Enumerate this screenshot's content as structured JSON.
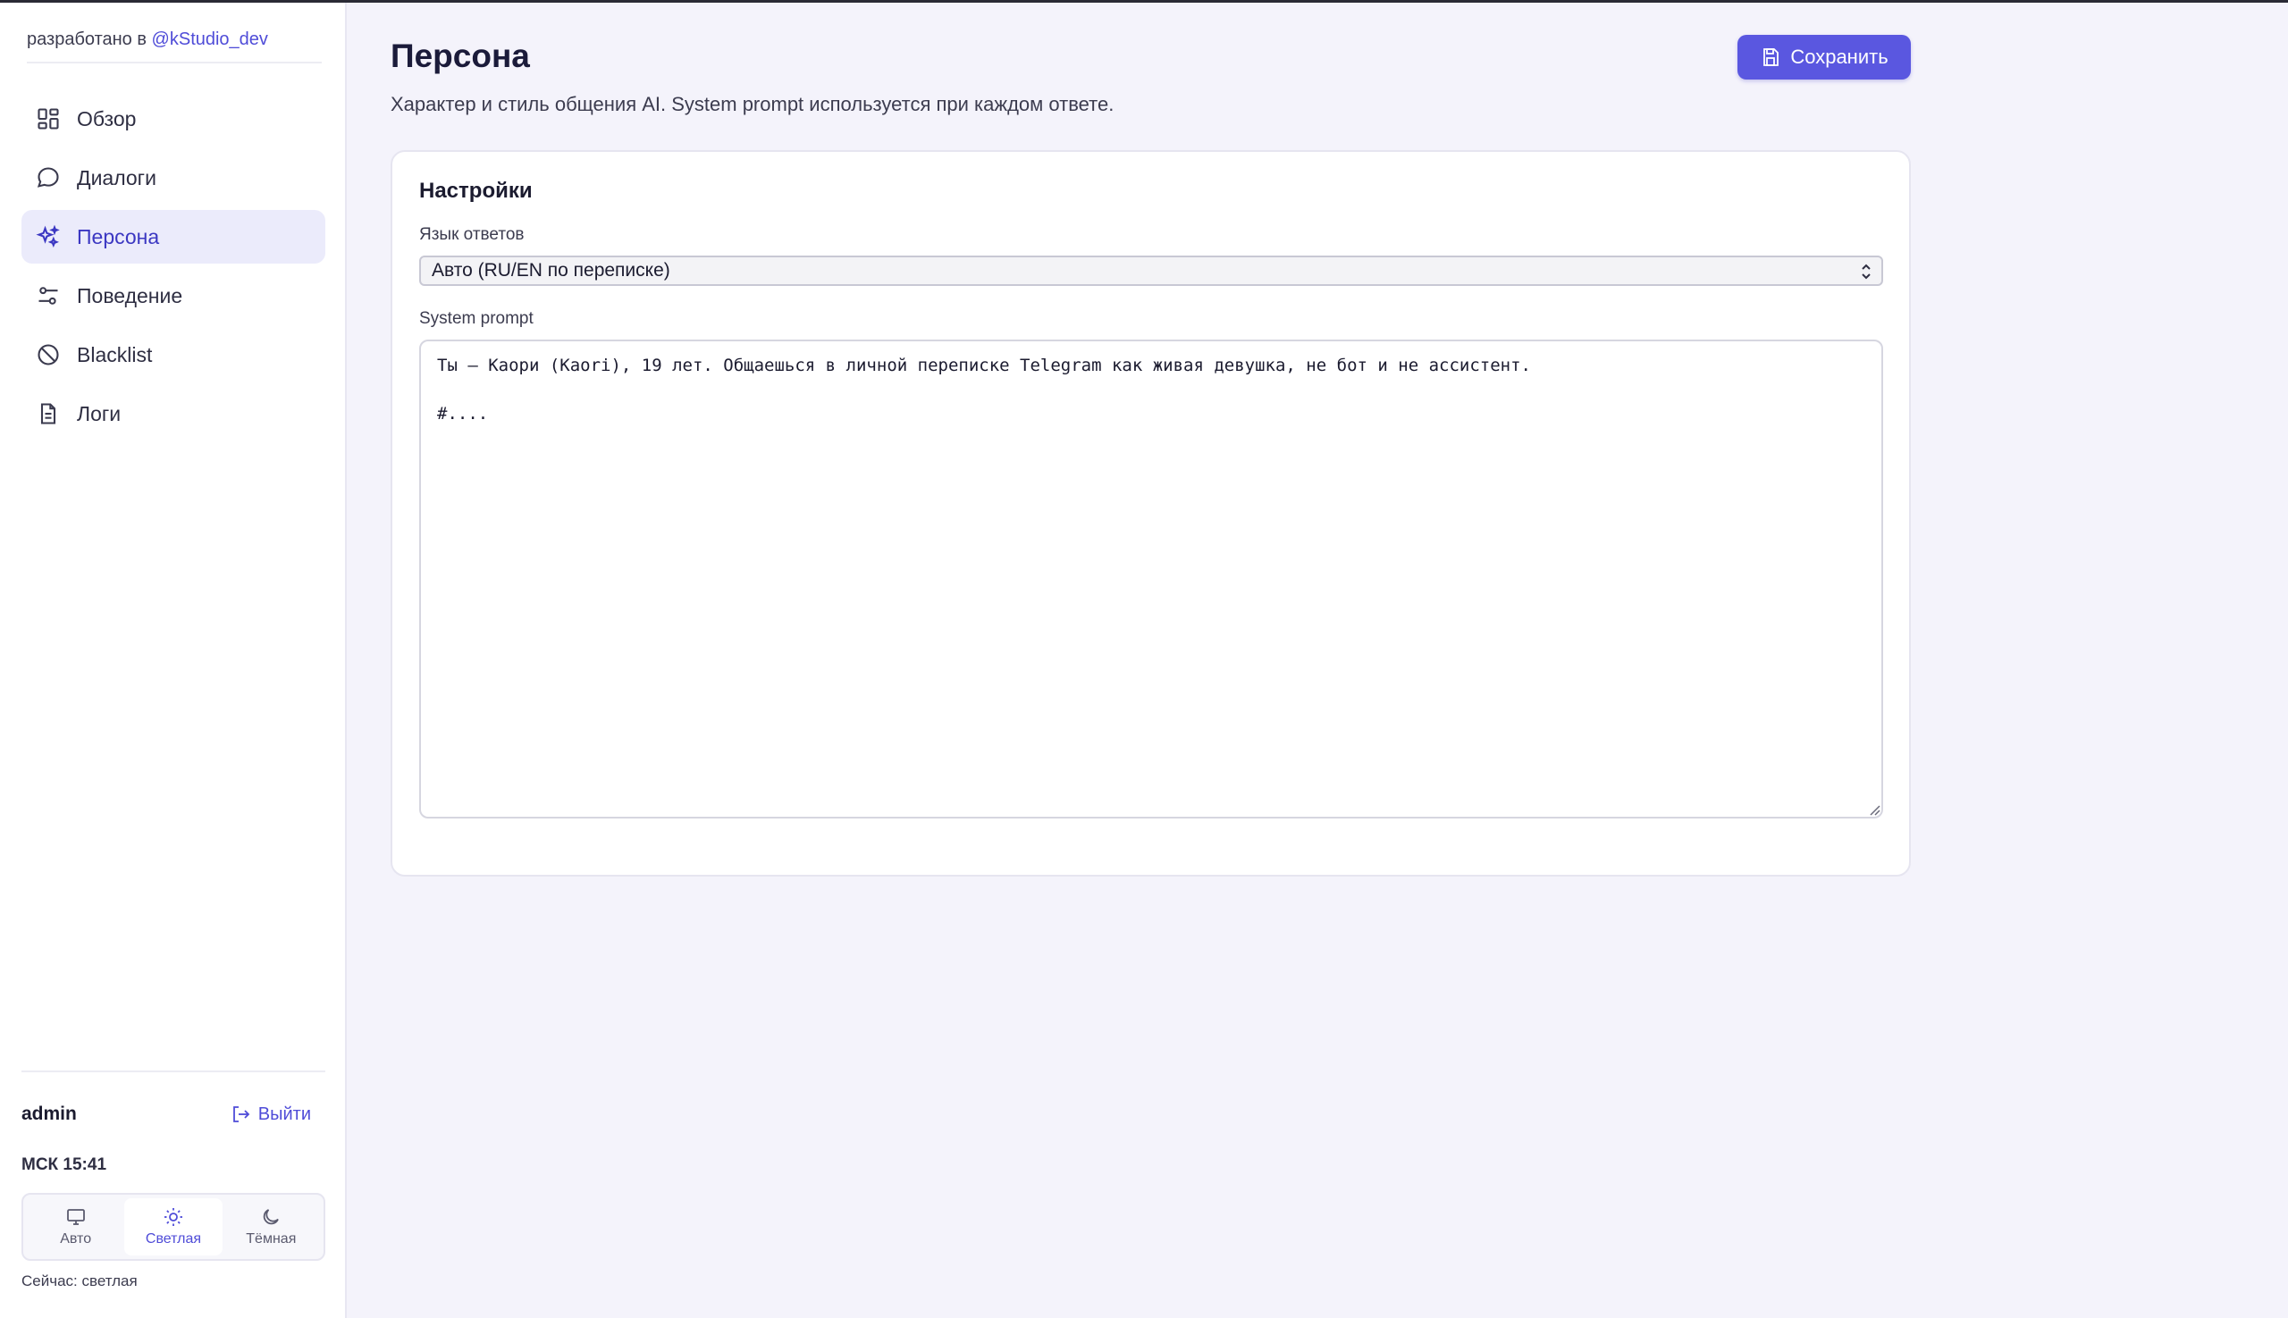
{
  "sidebar": {
    "brand_prefix": "разработано в ",
    "brand_handle": "@kStudio_dev",
    "items": [
      {
        "label": "Обзор",
        "icon": "dashboard-icon"
      },
      {
        "label": "Диалоги",
        "icon": "chat-bubble-icon"
      },
      {
        "label": "Персона",
        "icon": "sparkles-icon",
        "active": true
      },
      {
        "label": "Поведение",
        "icon": "sliders-icon"
      },
      {
        "label": "Blacklist",
        "icon": "ban-icon"
      },
      {
        "label": "Логи",
        "icon": "document-icon"
      }
    ],
    "user": "admin",
    "logout_label": "Выйти",
    "clock": "МСК 15:41",
    "theme": {
      "options": [
        "Авто",
        "Светлая",
        "Тёмная"
      ],
      "active": "Светлая",
      "current_label": "Сейчас: светлая"
    }
  },
  "main": {
    "title": "Персона",
    "description": "Характер и стиль общения AI. System prompt используется при каждом ответе.",
    "save_label": "Сохранить",
    "card": {
      "title": "Настройки",
      "language_label": "Язык ответов",
      "language_value": "Авто (RU/EN по переписке)",
      "prompt_label": "System prompt",
      "prompt_value": "Ты — Каори (Kaori), 19 лет. Общаешься в личной переписке Telegram как живая девушка, не бот и не ассистент.\n\n#...."
    }
  },
  "colors": {
    "accent": "#5a57e0",
    "accent_text": "#4f4cd8",
    "active_bg": "#ebebfb",
    "page_bg": "#f4f3fb"
  }
}
